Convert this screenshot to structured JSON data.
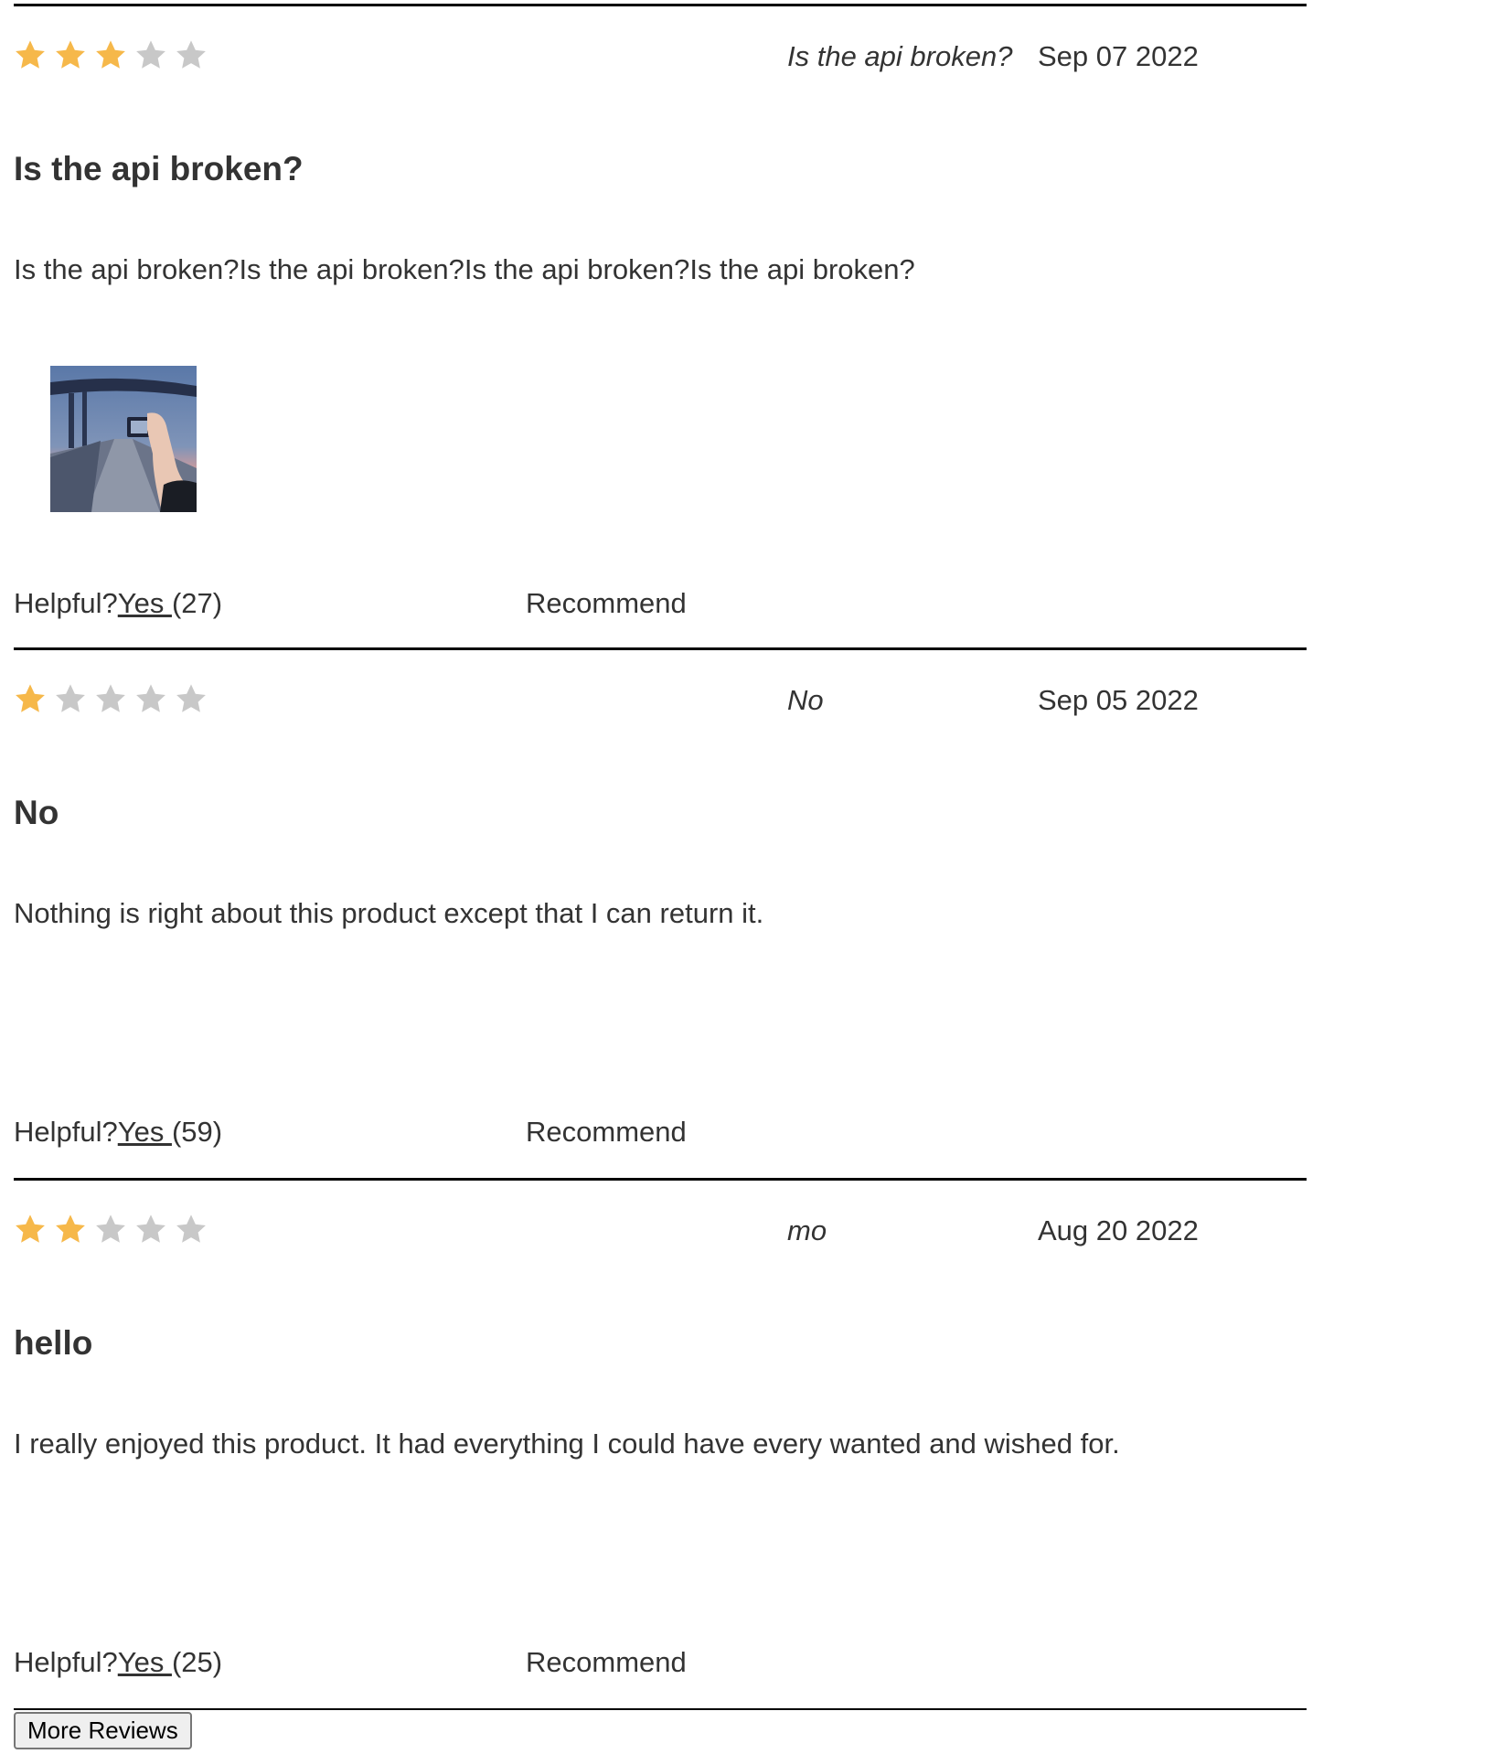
{
  "colors": {
    "star_filled": "#f6b84a",
    "star_empty": "#c8c8c8",
    "text": "#333333",
    "divider": "#000000"
  },
  "icons": {
    "star": "star-icon",
    "photo": "review-photo-thumbnail"
  },
  "reviews": [
    {
      "rating": 3,
      "max_rating": 5,
      "author": "Is the api broken?",
      "date": "Sep 07 2022",
      "title": "Is the api broken?",
      "body": "Is the api broken?Is the api broken?Is the api broken?Is the api broken?",
      "has_photo": true,
      "helpful_label": "Helpful?",
      "yes_label": "Yes ",
      "yes_count": "(27)",
      "recommend_label": "Recommend"
    },
    {
      "rating": 1,
      "max_rating": 5,
      "author": "No",
      "date": "Sep 05 2022",
      "title": "No",
      "body": "Nothing is right about this product except that I can return it.",
      "has_photo": false,
      "helpful_label": "Helpful?",
      "yes_label": "Yes ",
      "yes_count": "(59)",
      "recommend_label": "Recommend"
    },
    {
      "rating": 2,
      "max_rating": 5,
      "author": "mo",
      "date": "Aug 20 2022",
      "title": "hello",
      "body": "I really enjoyed this product. It had everything I could have every wanted and wished for.",
      "has_photo": false,
      "helpful_label": "Helpful?",
      "yes_label": "Yes ",
      "yes_count": "(25)",
      "recommend_label": "Recommend"
    }
  ],
  "more_reviews_label": "More Reviews"
}
